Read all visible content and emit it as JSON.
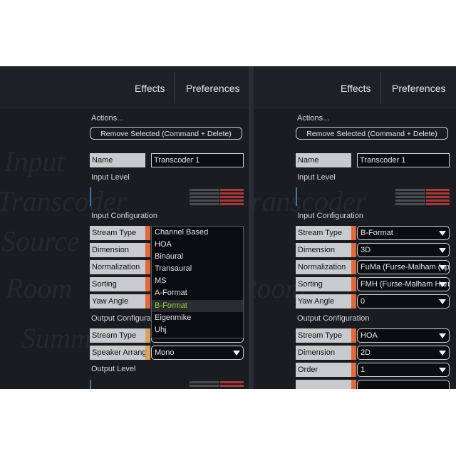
{
  "menu": {
    "effects": "Effects",
    "preferences": "Preferences"
  },
  "background_words": [
    "Input",
    "Transcoder",
    "Source",
    "Room",
    "Summ"
  ],
  "actions": {
    "title": "Actions...",
    "remove_button": "Remove Selected   (Command + Delete)"
  },
  "name_field": {
    "label": "Name",
    "value": "Transcoder 1"
  },
  "sections": {
    "input_level": "Input Level",
    "input_configuration": "Input Configuration",
    "output_configuration": "Output Configuration",
    "output_configuration_truncated": "Output Configurat",
    "output_level": "Output Level"
  },
  "colors": {
    "orange": "#e0683a",
    "tan": "#d9a45a",
    "meter_red": "#a83838",
    "selected_green": "#9bd33a"
  },
  "left_panel": {
    "input_rows": [
      {
        "label": "Stream Type",
        "value": ""
      },
      {
        "label": "Dimension",
        "value": ""
      },
      {
        "label": "Normalization",
        "value": ""
      },
      {
        "label": "Sorting",
        "value": ""
      },
      {
        "label": "Yaw Angle",
        "value": ""
      }
    ],
    "dropdown_options": [
      "Channel Based",
      "HOA",
      "Binaural",
      "Transaural",
      "MS",
      "A-Format",
      "B-Format",
      "Eigenmike",
      "Uhj"
    ],
    "dropdown_selected": "B-Format",
    "output_rows": [
      {
        "label": "Stream Type",
        "value": ""
      },
      {
        "label": "Speaker Arranger",
        "value": "Mono"
      }
    ]
  },
  "right_panel": {
    "input_rows": [
      {
        "label": "Stream Type",
        "value": "B-Format"
      },
      {
        "label": "Dimension",
        "value": "3D"
      },
      {
        "label": "Normalization",
        "value": "FuMa (Furse-Malham (upto"
      },
      {
        "label": "Sorting",
        "value": "FMH (Furse-Malham Harm"
      },
      {
        "label": "Yaw Angle",
        "value": "0"
      }
    ],
    "output_rows": [
      {
        "label": "Stream Type",
        "value": "HOA"
      },
      {
        "label": "Dimension",
        "value": "2D"
      },
      {
        "label": "Order",
        "value": "1"
      }
    ]
  }
}
